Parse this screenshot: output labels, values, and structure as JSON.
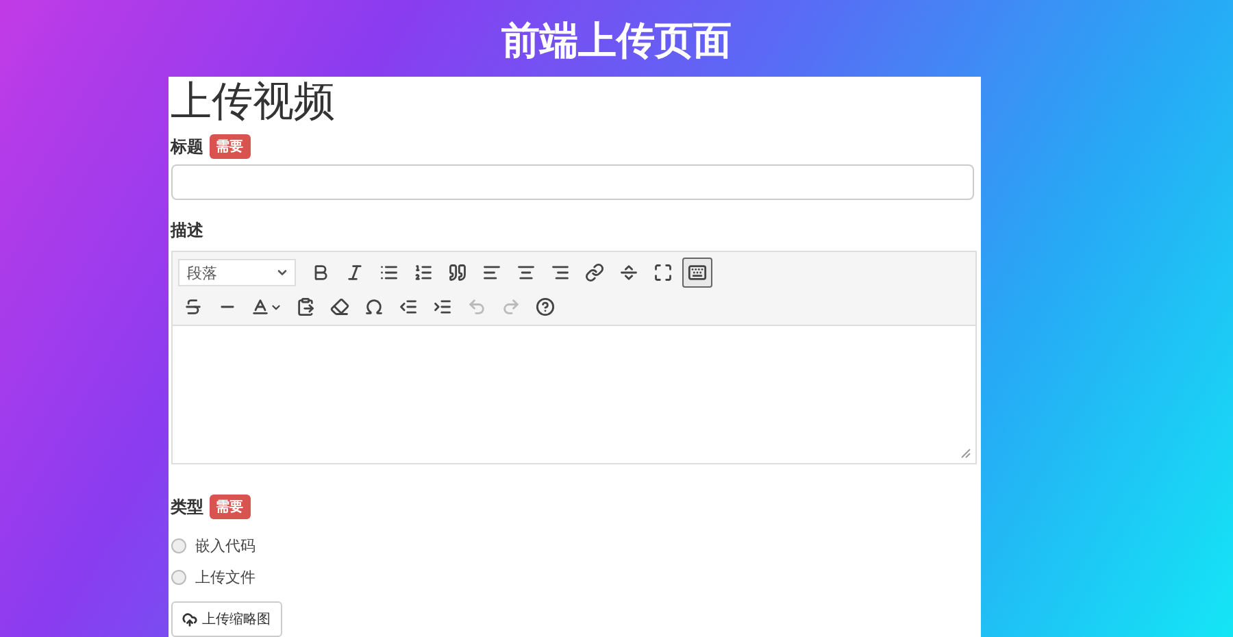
{
  "page_title": "前端上传页面",
  "form": {
    "heading": "上传视频",
    "title_field": {
      "label": "标题",
      "badge": "需要"
    },
    "description": {
      "label": "描述",
      "format_select": "段落",
      "toolbar_rows": [
        [
          {
            "kind": "bold",
            "pressed": false,
            "disabled": false
          },
          {
            "kind": "italic",
            "pressed": false,
            "disabled": false
          },
          {
            "kind": "bullet-list",
            "pressed": false,
            "disabled": false
          },
          {
            "kind": "numbered-list",
            "pressed": false,
            "disabled": false
          },
          {
            "kind": "quote",
            "pressed": false,
            "disabled": false
          },
          {
            "kind": "align-left",
            "pressed": false,
            "disabled": false
          },
          {
            "kind": "align-center",
            "pressed": false,
            "disabled": false
          },
          {
            "kind": "align-right",
            "pressed": false,
            "disabled": false
          },
          {
            "kind": "link",
            "pressed": false,
            "disabled": false
          },
          {
            "kind": "read-more",
            "pressed": false,
            "disabled": false
          },
          {
            "kind": "fullscreen",
            "pressed": false,
            "disabled": false
          },
          {
            "kind": "toolbar-toggle",
            "pressed": true,
            "disabled": false
          }
        ],
        [
          {
            "kind": "strikethrough",
            "pressed": false,
            "disabled": false
          },
          {
            "kind": "horizontal-line",
            "pressed": false,
            "disabled": false
          },
          {
            "kind": "text-color",
            "pressed": false,
            "disabled": false
          },
          {
            "kind": "paste-text",
            "pressed": false,
            "disabled": false
          },
          {
            "kind": "clear-format",
            "pressed": false,
            "disabled": false
          },
          {
            "kind": "special-char",
            "pressed": false,
            "disabled": false
          },
          {
            "kind": "outdent",
            "pressed": false,
            "disabled": false
          },
          {
            "kind": "indent",
            "pressed": false,
            "disabled": false
          },
          {
            "kind": "undo",
            "pressed": false,
            "disabled": true
          },
          {
            "kind": "redo",
            "pressed": false,
            "disabled": true
          },
          {
            "kind": "help",
            "pressed": false,
            "disabled": false
          }
        ]
      ]
    },
    "type_field": {
      "label": "类型",
      "badge": "需要",
      "options": [
        {
          "label": "嵌入代码",
          "selected": false
        },
        {
          "label": "上传文件",
          "selected": false
        }
      ]
    },
    "upload_button": "上传缩略图"
  }
}
